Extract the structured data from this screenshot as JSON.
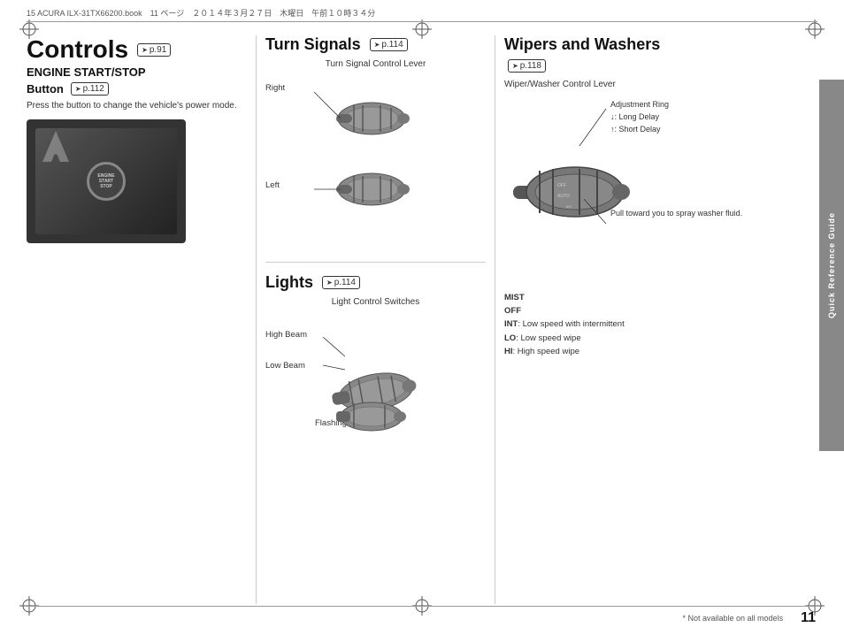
{
  "meta": {
    "file_info": "15 ACURA ILX-31TX66200.book　11 ページ　２０１４年３月２７日　木曜日　午前１０時３４分"
  },
  "page_number": "11",
  "sidebar_label": "Quick Reference Guide",
  "bottom_note": "* Not available on all models",
  "controls": {
    "main_title": "Controls",
    "main_ref": "p.91",
    "engine_section": {
      "title": "ENGINE START/STOP",
      "subtitle": "Button",
      "ref": "p.112",
      "body": "Press the button to change the vehicle's power mode."
    }
  },
  "turn_signals": {
    "title": "Turn Signals",
    "ref": "p.114",
    "lever_label": "Turn Signal Control Lever",
    "right_label": "Right",
    "left_label": "Left"
  },
  "lights": {
    "title": "Lights",
    "ref": "p.114",
    "switches_label": "Light Control Switches",
    "high_beam_label": "High Beam",
    "low_beam_label": "Low Beam",
    "flashing_label": "Flashing"
  },
  "wipers": {
    "title": "Wipers and Washers",
    "ref": "p.118",
    "lever_label": "Wiper/Washer Control Lever",
    "adjustment_ring_label": "Adjustment Ring",
    "long_delay_label": "↓: Long Delay",
    "short_delay_label": "↑: Short Delay",
    "pull_label": "Pull toward you to spray washer fluid.",
    "status_labels": [
      "MIST",
      "OFF",
      "INT: Low speed with intermittent",
      "LO: Low speed wipe",
      "HI: High speed wipe"
    ]
  }
}
